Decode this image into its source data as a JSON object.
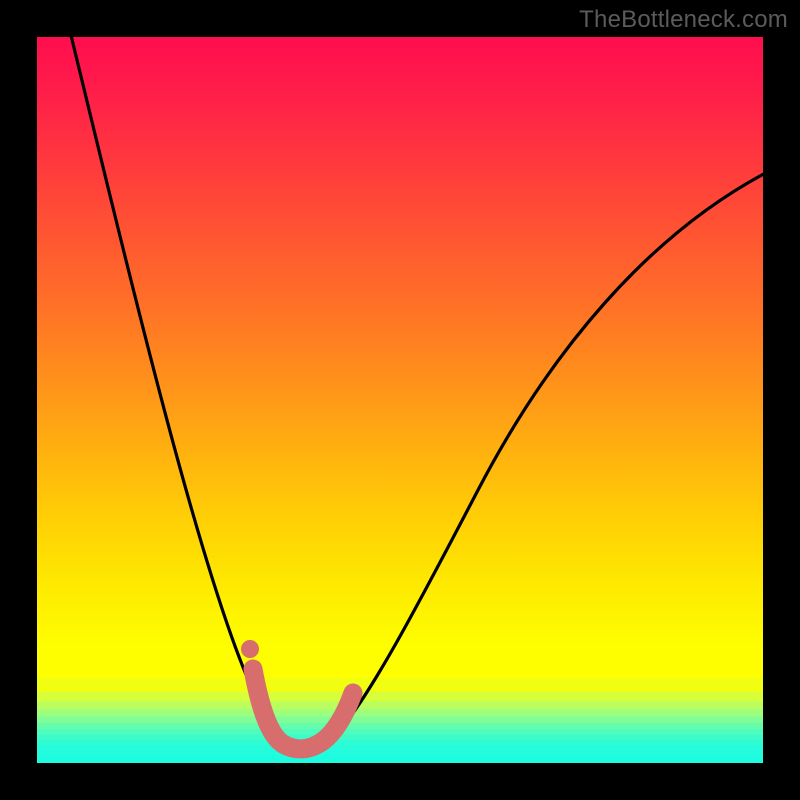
{
  "watermark": "TheBottleneck.com",
  "chart_data": {
    "type": "line",
    "title": "",
    "xlabel": "",
    "ylabel": "",
    "xlim": [
      0,
      100
    ],
    "ylim": [
      0,
      100
    ],
    "grid": false,
    "legend": false,
    "background": {
      "kind": "vertical-gradient",
      "stops": [
        {
          "pct": 0,
          "color": "#ff0e4e"
        },
        {
          "pct": 22,
          "color": "#ff4638"
        },
        {
          "pct": 48,
          "color": "#ff931a"
        },
        {
          "pct": 76,
          "color": "#feeb00"
        },
        {
          "pct": 88,
          "color": "#fefe00"
        },
        {
          "pct": 100,
          "color": "#1efcdf"
        }
      ],
      "green_bands": [
        "#f2fe11",
        "#d7fe3a",
        "#b9fe5e",
        "#9dfd7d",
        "#80fd97",
        "#65fdac",
        "#4efdbd",
        "#3dfcc9",
        "#2ffcd2",
        "#26fcd9",
        "#20fcdd",
        "#1efcdf"
      ]
    },
    "series": [
      {
        "name": "bottleneck-curve",
        "color": "#000000",
        "x": [
          4,
          10,
          15,
          20,
          25,
          30,
          33,
          35,
          37,
          40,
          45,
          52,
          60,
          70,
          83,
          100
        ],
        "y": [
          102,
          80,
          62,
          45,
          30,
          16,
          8,
          3,
          1,
          3,
          12,
          28,
          44,
          60,
          74,
          82
        ]
      }
    ],
    "annotations": [
      {
        "name": "trough-marker",
        "kind": "thick-path",
        "color": "#d76d6d",
        "x": [
          30,
          32,
          34,
          36,
          38,
          40,
          42,
          44
        ],
        "y": [
          13,
          7,
          3,
          1,
          1,
          3,
          6,
          10
        ]
      },
      {
        "name": "trough-dot",
        "kind": "point",
        "color": "#d76d6d",
        "x": 29.3,
        "y": 15.7
      }
    ]
  }
}
